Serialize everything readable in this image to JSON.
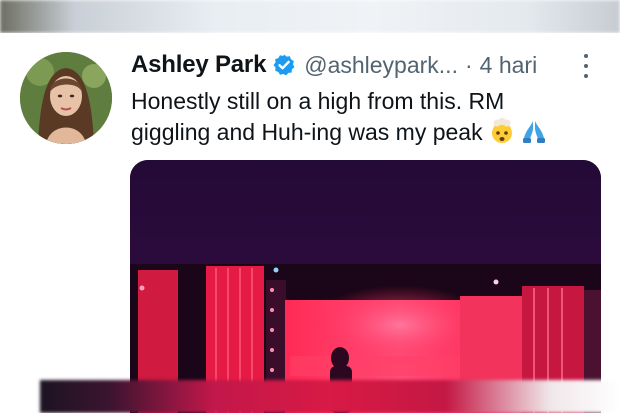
{
  "tweet": {
    "display_name": "Ashley Park",
    "handle": "@ashleypark...",
    "separator": "·",
    "timestamp": "4 hari",
    "text_line1": "Honestly still on a high from this. RM",
    "text_line2": "giggling and Huh-ing was my peak",
    "emojis": [
      "exploding-head-emoji",
      "folded-hands-emoji"
    ],
    "verified": true
  },
  "colors": {
    "name": "#0f1419",
    "secondary": "#536471",
    "verified_badge": "#1d9bf0",
    "media_stage": "#e8184b"
  },
  "icons": [
    "verified-badge-icon",
    "more-options-icon"
  ]
}
